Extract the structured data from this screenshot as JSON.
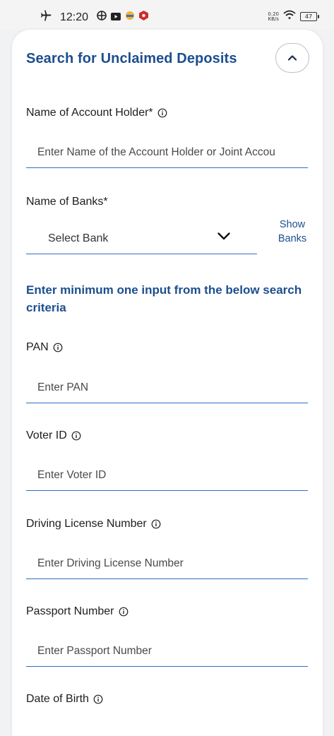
{
  "status_bar": {
    "time": "12:20",
    "net_speed_value": "0.20",
    "net_speed_unit": "KB/s",
    "battery": "47",
    "icons": [
      "airplane-icon",
      "target-icon",
      "youtube-icon",
      "app-icon",
      "shield-app-icon",
      "wifi-icon"
    ]
  },
  "card": {
    "title": "Search for Unclaimed Deposits",
    "fields": {
      "account_holder": {
        "label": "Name of Account Holder*",
        "placeholder": "Enter Name of the Account Holder or Joint Accou"
      },
      "banks": {
        "label": "Name of Banks*",
        "selected": "Select Bank",
        "show_banks_line1": "Show",
        "show_banks_line2": "Banks"
      },
      "criteria_heading": "Enter minimum one input from the below search criteria",
      "pan": {
        "label": "PAN",
        "placeholder": "Enter PAN"
      },
      "voter_id": {
        "label": "Voter ID",
        "placeholder": "Enter Voter ID"
      },
      "driving_license": {
        "label": "Driving License Number",
        "placeholder": "Enter Driving License Number"
      },
      "passport": {
        "label": "Passport Number",
        "placeholder": "Enter Passport Number"
      },
      "dob": {
        "label": "Date of Birth"
      }
    }
  },
  "colors": {
    "accent": "#1c4e8f",
    "underline": "#2e6ec0",
    "background": "#f1f2f4"
  }
}
